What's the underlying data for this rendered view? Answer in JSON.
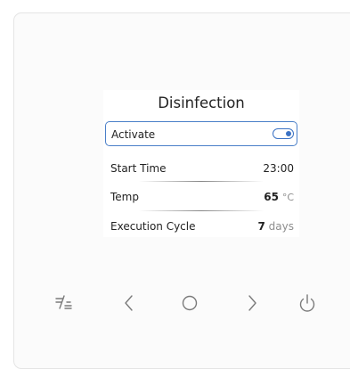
{
  "screen": {
    "title": "Disinfection",
    "rows": [
      {
        "label": "Activate",
        "type": "toggle",
        "toggle_on": true,
        "selected": true
      },
      {
        "label": "Start Time",
        "type": "value",
        "value": "23:00",
        "unit": ""
      },
      {
        "label": "Temp",
        "type": "value",
        "value": "65",
        "unit": "°C"
      },
      {
        "label": "Execution Cycle",
        "type": "value",
        "value": "7",
        "unit": "days"
      }
    ]
  },
  "buttons": [
    {
      "name": "menu-icon"
    },
    {
      "name": "chevron-left-icon"
    },
    {
      "name": "home-circle-icon"
    },
    {
      "name": "chevron-right-icon"
    },
    {
      "name": "power-icon"
    }
  ],
  "colors": {
    "accent": "#3b72c4",
    "selection_border": "#4a7fc8",
    "icon": "#7a7a7a"
  }
}
